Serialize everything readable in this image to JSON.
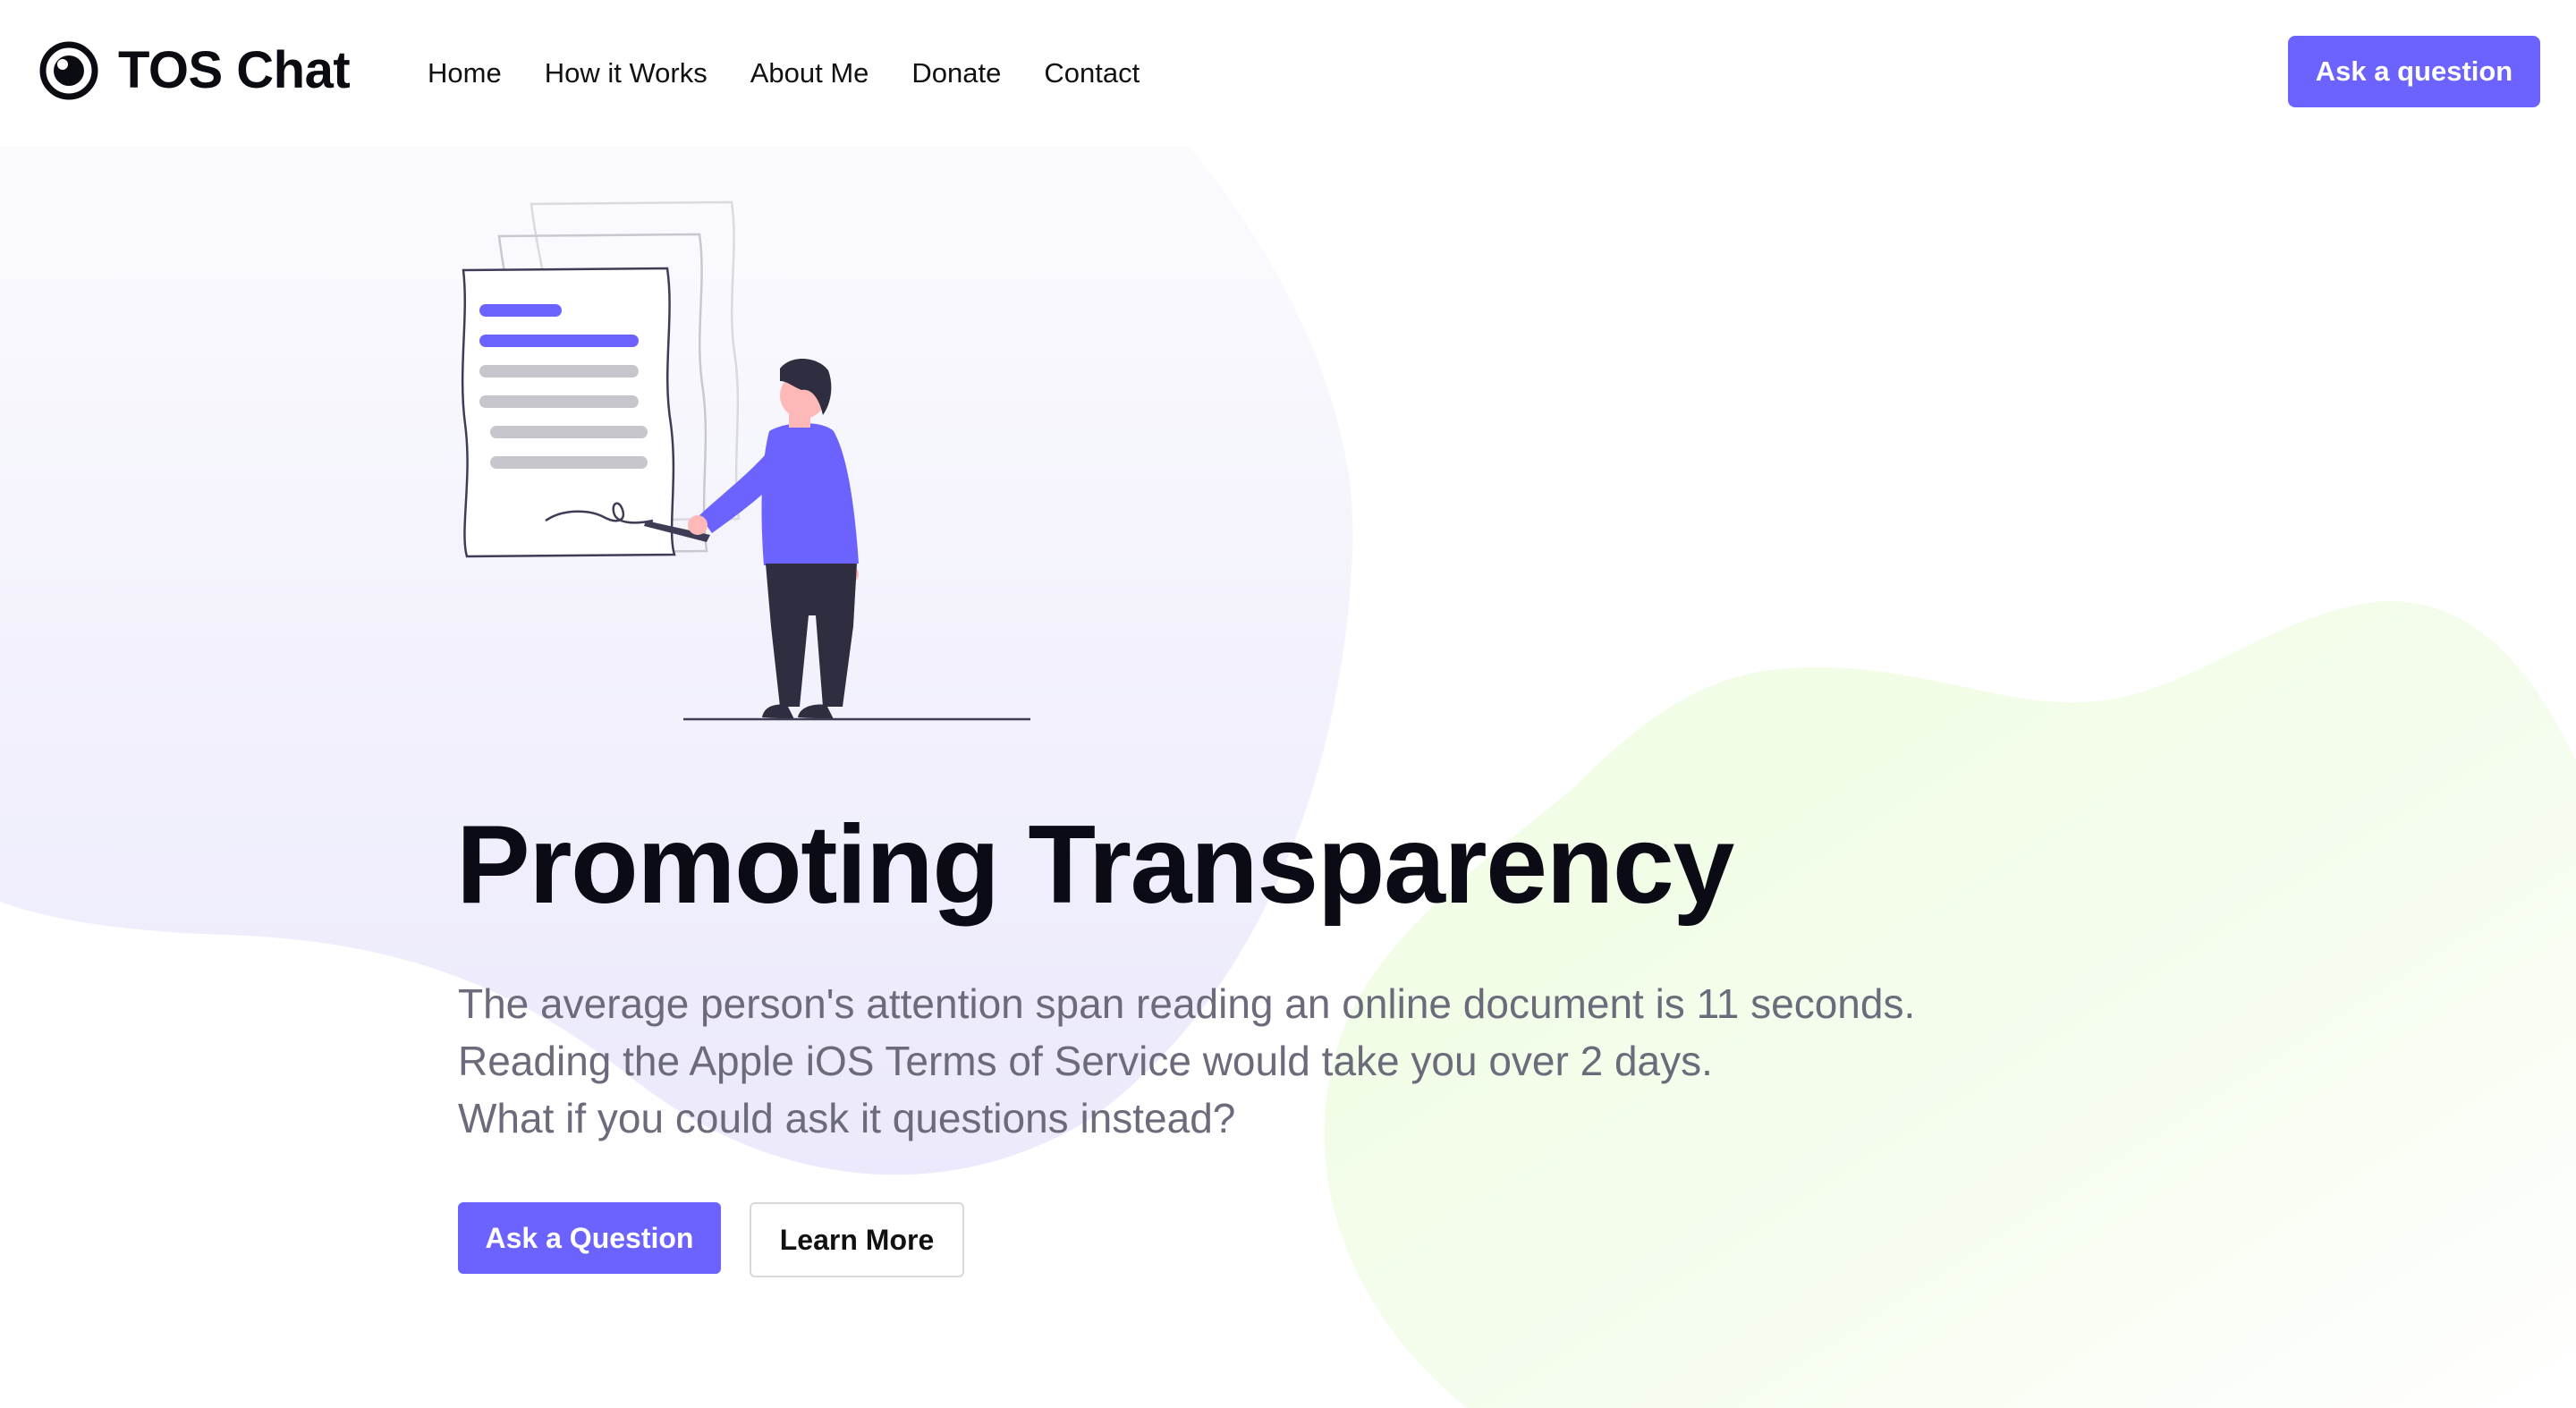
{
  "brand": {
    "name": "TOS Chat",
    "icon": "eye-logo-icon"
  },
  "nav": {
    "items": [
      {
        "label": "Home"
      },
      {
        "label": "How it Works"
      },
      {
        "label": "About Me"
      },
      {
        "label": "Donate"
      },
      {
        "label": "Contact"
      }
    ]
  },
  "header": {
    "cta_label": "Ask a question"
  },
  "hero": {
    "title": "Promoting Transparency",
    "subtitle_lines": [
      "The average person's attention span reading an online document is 11 seconds.",
      "Reading the Apple iOS Terms of Service would take you over 2 days.",
      "What if you could ask it questions instead?"
    ],
    "primary_button": "Ask a Question",
    "secondary_button": "Learn More",
    "illustration": "person-signing-document-illustration"
  },
  "colors": {
    "accent": "#6c63ff",
    "title": "#0b0b16",
    "body_text": "#6b6b7b",
    "blob_purple": "#eeecfc",
    "blob_green": "#f0fde4"
  }
}
